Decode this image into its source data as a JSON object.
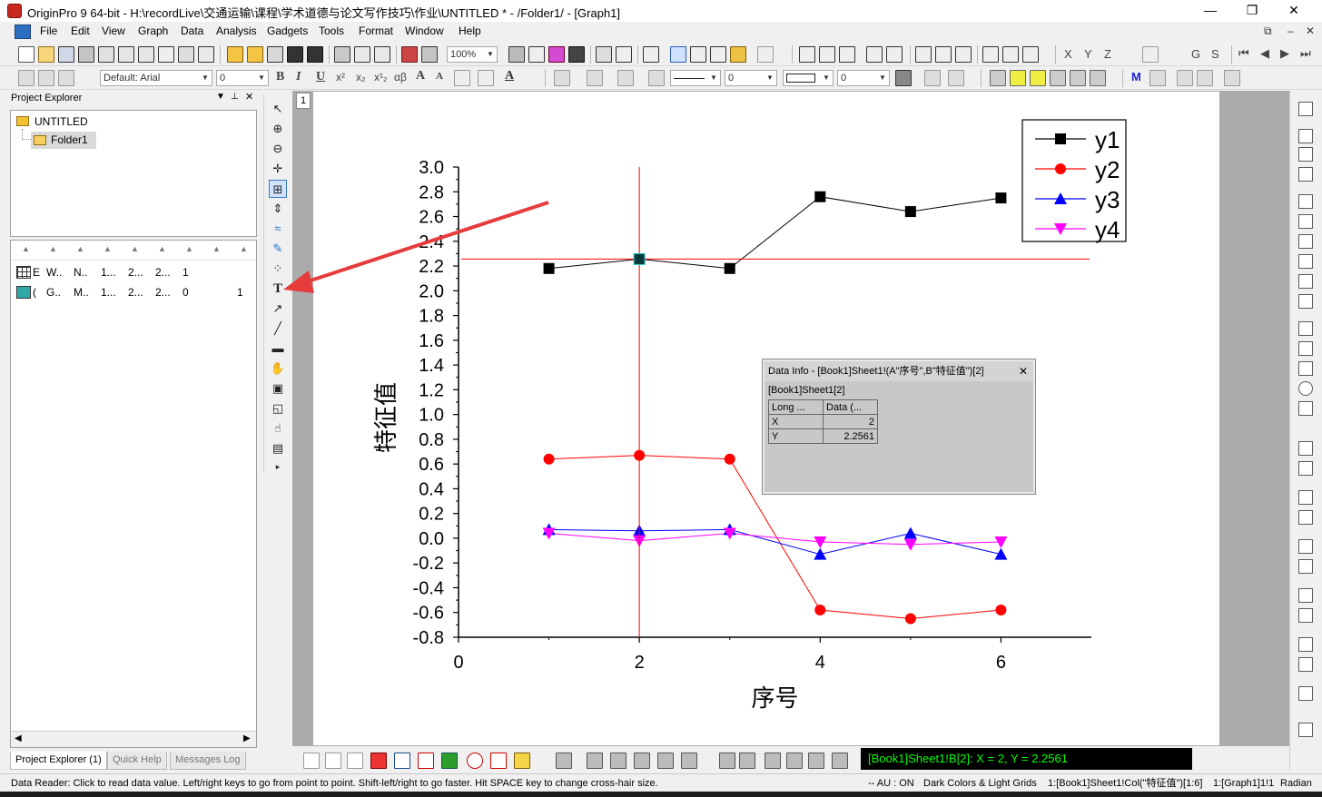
{
  "window": {
    "title": "OriginPro 9 64-bit - H:\\recordLive\\交通运输\\课程\\学术道德与论文写作技巧\\作业\\UNTITLED * - /Folder1/ - [Graph1]",
    "min": "—",
    "max": "❐",
    "close": "✕"
  },
  "menu": [
    "File",
    "Edit",
    "View",
    "Graph",
    "Data",
    "Analysis",
    "Gadgets",
    "Tools",
    "Format",
    "Window",
    "Help"
  ],
  "toolbar": {
    "zoom": "100%",
    "font": "Default: Arial",
    "font_size": "0",
    "line_width": "0",
    "pattern_width": "0",
    "subscript_labels": [
      "x²",
      "x₂",
      "x¹₂",
      "αβ"
    ],
    "letters": [
      "X",
      "Y",
      "Z",
      "G",
      "S"
    ]
  },
  "project_explorer": {
    "title": "Project Explorer",
    "root": "UNTITLED",
    "folder": "Folder1",
    "rows": [
      {
        "c1": "E",
        "c2": "W..",
        "c3": "N..",
        "c4": "1...",
        "c5": "2...",
        "c6": "2...",
        "c7": "1",
        "c8": ""
      },
      {
        "c1": "(",
        "c2": "G..",
        "c3": "M..",
        "c4": "1...",
        "c5": "2...",
        "c6": "2...",
        "c7": "0",
        "c8": "1"
      }
    ],
    "tabs": [
      "Project Explorer (1)",
      "Quick Help",
      "Messages Log"
    ]
  },
  "graph": {
    "layer_label": "1"
  },
  "chart_data": {
    "type": "line",
    "xlabel": "序号",
    "ylabel": "特征值",
    "xlim": [
      0,
      7
    ],
    "ylim": [
      -0.8,
      3.0
    ],
    "xticks": [
      0,
      2,
      4,
      6
    ],
    "yticks": [
      -0.8,
      -0.6,
      -0.4,
      -0.2,
      0.0,
      0.2,
      0.4,
      0.6,
      0.8,
      1.0,
      1.2,
      1.4,
      1.6,
      1.8,
      2.0,
      2.2,
      2.4,
      2.6,
      2.8,
      3.0
    ],
    "yticklabels": [
      "-0.8",
      "-0.6",
      "-0.4",
      "-0.2",
      "0.0",
      "0.2",
      "0.4",
      "0.6",
      "0.8",
      "1.0",
      "1.2",
      "1.4",
      "1.6",
      "1.8",
      "2.0",
      "2.2",
      "2.4",
      "2.6",
      "2.8",
      "3.0"
    ],
    "x": [
      1,
      2,
      3,
      4,
      5,
      6
    ],
    "series": [
      {
        "name": "y1",
        "color": "#000000",
        "marker": "square",
        "values": [
          2.18,
          2.2561,
          2.18,
          2.76,
          2.64,
          2.75
        ]
      },
      {
        "name": "y2",
        "color": "#ff0000",
        "marker": "circle",
        "values": [
          0.64,
          0.67,
          0.64,
          -0.58,
          -0.65,
          -0.58
        ]
      },
      {
        "name": "y3",
        "color": "#0000ff",
        "marker": "triangle-up",
        "values": [
          0.07,
          0.06,
          0.07,
          -0.13,
          0.04,
          -0.13
        ]
      },
      {
        "name": "y4",
        "color": "#ff00ff",
        "marker": "triangle-down",
        "values": [
          0.04,
          -0.02,
          0.04,
          -0.03,
          -0.05,
          -0.03
        ]
      }
    ],
    "crosshair": {
      "x": 2,
      "y": 2.2561,
      "color": "#ff0000"
    },
    "legend": "top-right"
  },
  "data_info": {
    "title": "Data Info - [Book1]Sheet1!(A\"序号\",B\"特征值\")[2]",
    "close": "✕",
    "sheet": "[Book1]Sheet1[2]",
    "head": [
      "Long ...",
      "Data (..."
    ],
    "rows": [
      {
        "k": "X",
        "v": "2"
      },
      {
        "k": "Y",
        "v": "2.2561"
      }
    ]
  },
  "readout": "[Book1]Sheet1!B[2]:  X = 2, Y = 2.2561",
  "status": {
    "left": "Data Reader: Click to read data value. Left/right keys to go from point to point. Shift-left/right to go faster. Hit SPACE key to change cross-hair size.",
    "au": "-- AU : ON",
    "theme": "Dark Colors & Light Grids",
    "col": "1:[Book1]Sheet1!Col(\"特征值\")[1:6]",
    "graph": "1:[Graph1]1!1",
    "unit": "Radian"
  }
}
